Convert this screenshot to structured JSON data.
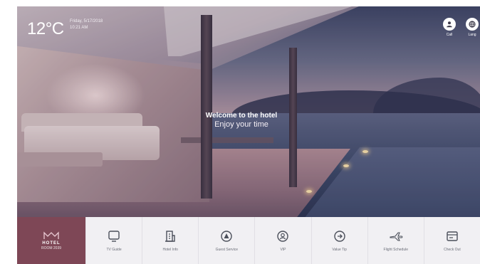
{
  "header": {
    "temperature": "12°C",
    "date": "Friday, 5/17/2018",
    "time": "10:21 AM"
  },
  "top_actions": [
    {
      "label": "Call",
      "icon": "person-icon"
    },
    {
      "label": "Lang",
      "icon": "globe-icon"
    }
  ],
  "welcome": {
    "title": "Welcome to the hotel",
    "subtitle": "Enjoy your time"
  },
  "brand": {
    "name": "HOTEL",
    "room": "ROOM 2039",
    "color": "#7e4756"
  },
  "menu": [
    {
      "label": "TV Guide",
      "icon": "tv-icon"
    },
    {
      "label": "Hotel Info",
      "icon": "building-icon"
    },
    {
      "label": "Guest Service",
      "icon": "bell-icon"
    },
    {
      "label": "VIP",
      "icon": "vip-icon"
    },
    {
      "label": "Value Tip",
      "icon": "tip-icon"
    },
    {
      "label": "Flight Schedule",
      "icon": "airplane-icon"
    },
    {
      "label": "Check Out",
      "icon": "checkout-icon"
    }
  ]
}
